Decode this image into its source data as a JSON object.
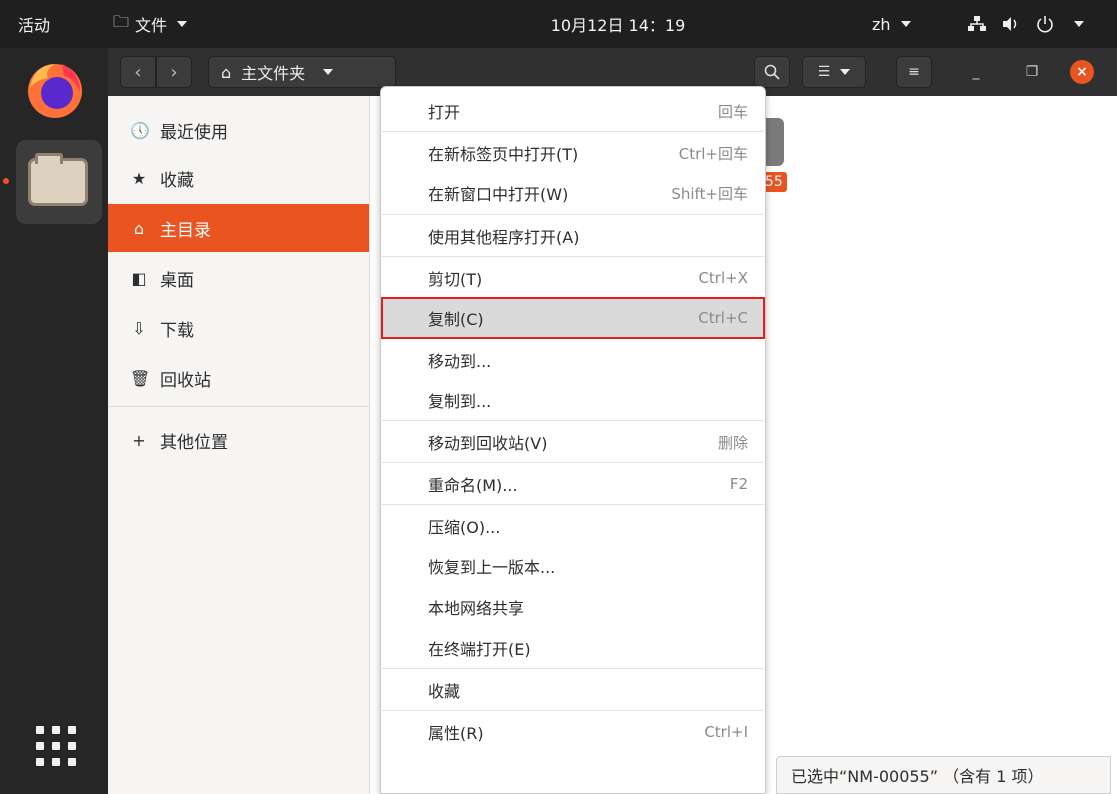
{
  "topbar": {
    "activities": "活动",
    "app_menu": "文件",
    "clock": "10月12日 14：19",
    "lang": "zh"
  },
  "header": {
    "path": "主文件夹"
  },
  "sidebar": {
    "items": [
      {
        "label": "最近使用",
        "icon": "clock-icon",
        "glyph": "🕔"
      },
      {
        "label": "收藏",
        "icon": "star-icon",
        "glyph": "★"
      },
      {
        "label": "主目录",
        "icon": "home-icon",
        "glyph": "⌂"
      },
      {
        "label": "桌面",
        "icon": "desktop-icon",
        "glyph": "◧"
      },
      {
        "label": "下载",
        "icon": "download-icon",
        "glyph": "⇩"
      },
      {
        "label": "回收站",
        "icon": "trash-icon",
        "glyph": "🗑"
      }
    ],
    "other": {
      "label": "其他位置",
      "glyph": "+"
    }
  },
  "content": {
    "selected_label": "055",
    "status": "已选中“NM-00055” （含有 1 项）"
  },
  "menu": {
    "items": [
      {
        "label": "打开",
        "shortcut": "回车"
      },
      {
        "label": "在新标签页中打开(T)",
        "shortcut": "Ctrl+回车"
      },
      {
        "label": "在新窗口中打开(W)",
        "shortcut": "Shift+回车"
      },
      {
        "label": "使用其他程序打开(A)",
        "shortcut": ""
      },
      {
        "label": "剪切(T)",
        "shortcut": "Ctrl+X"
      },
      {
        "label": "复制(C)",
        "shortcut": "Ctrl+C"
      },
      {
        "label": "移动到...",
        "shortcut": ""
      },
      {
        "label": "复制到...",
        "shortcut": ""
      },
      {
        "label": "移动到回收站(V)",
        "shortcut": "删除"
      },
      {
        "label": "重命名(M)...",
        "shortcut": "F2"
      },
      {
        "label": "压缩(O)...",
        "shortcut": ""
      },
      {
        "label": "恢复到上一版本...",
        "shortcut": ""
      },
      {
        "label": "本地网络共享",
        "shortcut": ""
      },
      {
        "label": "在终端打开(E)",
        "shortcut": ""
      },
      {
        "label": "收藏",
        "shortcut": ""
      },
      {
        "label": "属性(R)",
        "shortcut": "Ctrl+I"
      }
    ]
  },
  "colors": {
    "accent": "#e95420",
    "highlight_border": "#e02020"
  }
}
